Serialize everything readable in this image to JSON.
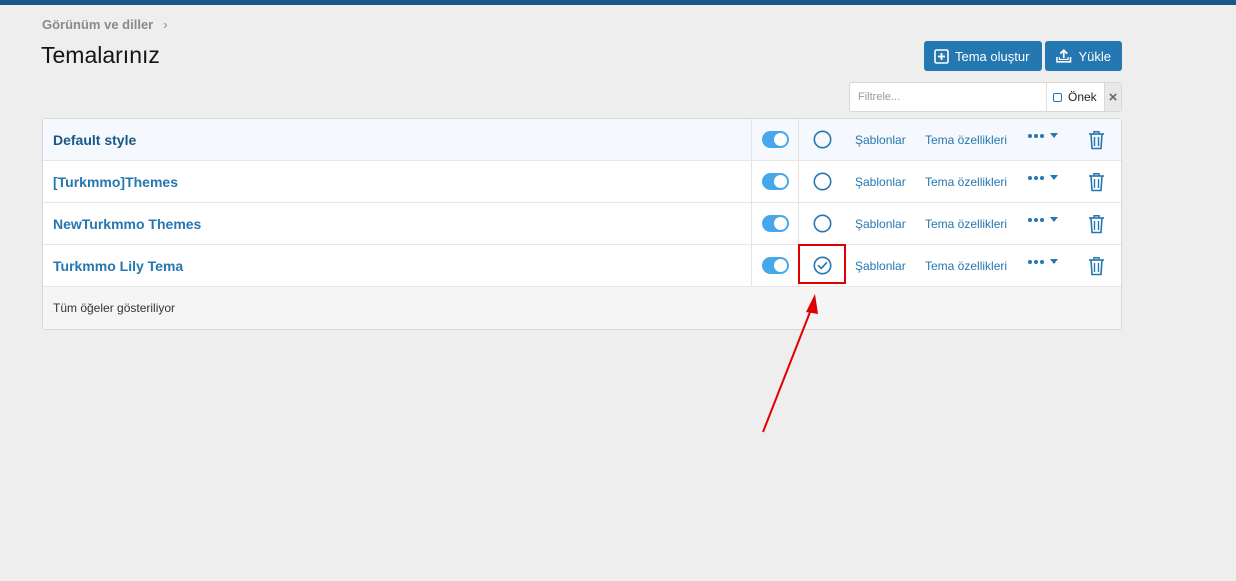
{
  "breadcrumb": {
    "label": "Görünüm ve diller",
    "separator": "›"
  },
  "page": {
    "title": "Temalarınız"
  },
  "toolbar": {
    "create_label": "Tema oluştur",
    "upload_label": "Yükle"
  },
  "filter": {
    "placeholder": "Filtrele...",
    "prefix_label": "Önek",
    "clear_label": "×"
  },
  "themes": [
    {
      "title": "Default style",
      "enabled": true,
      "default": false,
      "templates_label": "Şablonlar",
      "properties_label": "Tema özellikleri"
    },
    {
      "title": "[Turkmmo]Themes",
      "enabled": true,
      "default": false,
      "templates_label": "Şablonlar",
      "properties_label": "Tema özellikleri"
    },
    {
      "title": "NewTurkmmo Themes",
      "enabled": true,
      "default": false,
      "templates_label": "Şablonlar",
      "properties_label": "Tema özellikleri"
    },
    {
      "title": "Turkmmo Lily Tema",
      "enabled": true,
      "default": true,
      "templates_label": "Şablonlar",
      "properties_label": "Tema özellikleri"
    }
  ],
  "list_footer": {
    "text": "Tüm öğeler gösteriliyor"
  },
  "colors": {
    "accent": "#2577b1",
    "toggle_on": "#47a7eb",
    "topbar": "#185886",
    "annotation": "#e00000"
  }
}
